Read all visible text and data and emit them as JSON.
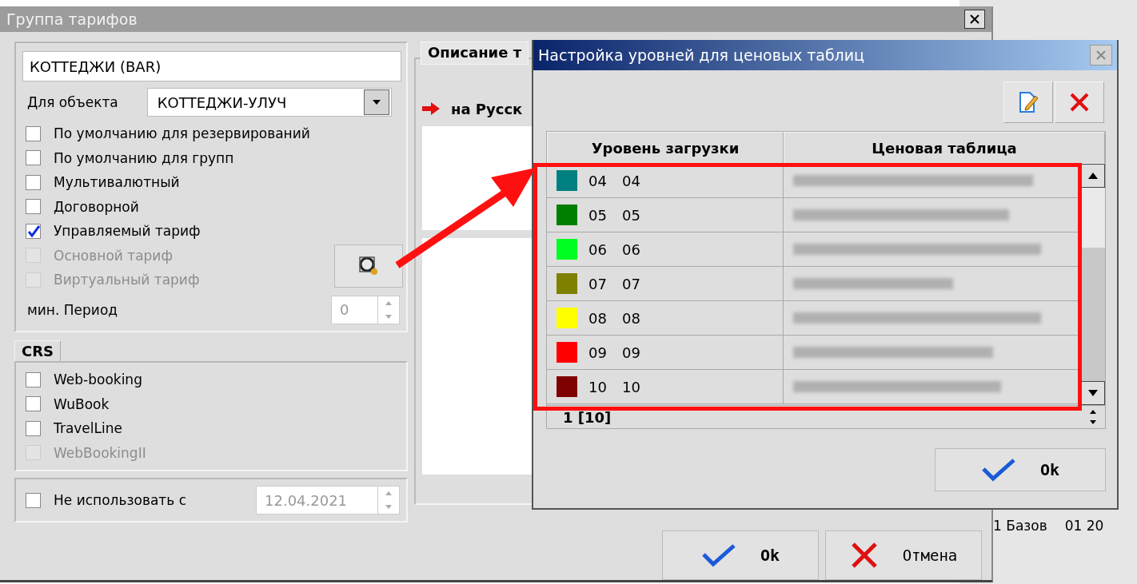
{
  "main_window": {
    "title": "Группа тарифов",
    "name_value": "КОТТЕДЖИ (BAR)",
    "object_label": "Для объекта",
    "object_value": "КОТТЕДЖИ-УЛУЧ",
    "options": [
      {
        "label": "По умолчанию для резервирований",
        "checked": false,
        "disabled": false
      },
      {
        "label": "По умолчанию для групп",
        "checked": false,
        "disabled": false
      },
      {
        "label": "Мультивалютный",
        "checked": false,
        "disabled": false
      },
      {
        "label": "Договорной",
        "checked": false,
        "disabled": false
      },
      {
        "label": "Управляемый тариф",
        "checked": true,
        "disabled": false
      },
      {
        "label": "Основной тариф",
        "checked": false,
        "disabled": true
      },
      {
        "label": "Виртуальный тариф",
        "checked": false,
        "disabled": true
      }
    ],
    "min_period_label": "мин. Период",
    "min_period_value": "0",
    "crs": {
      "title": "CRS",
      "options": [
        {
          "label": "Web-booking",
          "checked": false,
          "disabled": false
        },
        {
          "label": "WuBook",
          "checked": false,
          "disabled": false
        },
        {
          "label": "TravelLine",
          "checked": false,
          "disabled": false
        },
        {
          "label": "WebBookingII",
          "checked": false,
          "disabled": true
        }
      ]
    },
    "not_use": {
      "label": "Не использовать с",
      "checked": false,
      "date": "12.04.2021"
    },
    "description_tab": "Описание т",
    "language_label": "на Русск",
    "buttons": [
      {
        "label": "Ok",
        "kind": "ok"
      },
      {
        "label": "Отмена",
        "kind": "cancel"
      }
    ]
  },
  "levels_window": {
    "title": "Настройка уровней для ценовых таблиц",
    "columns": [
      "Уровень загрузки",
      "Ценовая таблица"
    ],
    "rows": [
      {
        "code": "04",
        "name": "04",
        "color": "#008080"
      },
      {
        "code": "05",
        "name": "05",
        "color": "#007f00"
      },
      {
        "code": "06",
        "name": "06",
        "color": "#00ff20"
      },
      {
        "code": "07",
        "name": "07",
        "color": "#808000"
      },
      {
        "code": "08",
        "name": "08",
        "color": "#ffff00"
      },
      {
        "code": "09",
        "name": "09",
        "color": "#ff0000"
      },
      {
        "code": "10",
        "name": "10",
        "color": "#7f0000"
      }
    ],
    "footer": "1 [10]",
    "ok_button": "Ok"
  },
  "background": {
    "cells": [
      "1 Базов",
      "01 20"
    ]
  }
}
